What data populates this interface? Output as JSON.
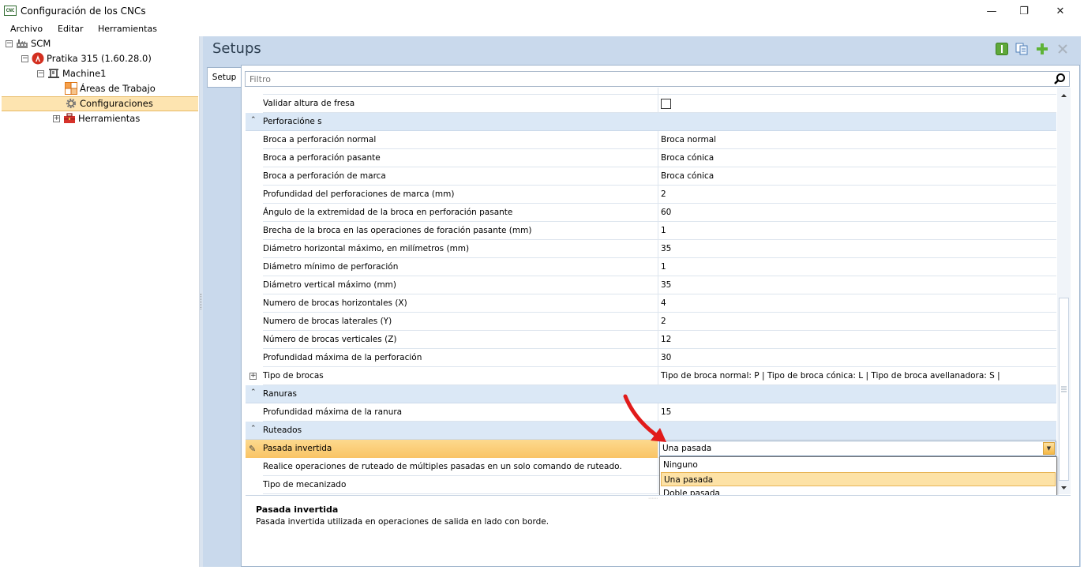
{
  "window": {
    "title": "Configuración de los CNCs",
    "icon_text": "CNC",
    "minimize": "—",
    "maximize": "❐",
    "close": "✕"
  },
  "menu": [
    "Archivo",
    "Editar",
    "Herramientas"
  ],
  "tree": {
    "root": "SCM",
    "machine_group": "Pratika 315 (1.60.28.0)",
    "machine": "Machine1",
    "items": [
      "Áreas de Trabajo",
      "Configuraciones",
      "Herramientas"
    ],
    "selected": "Configuraciones"
  },
  "header": {
    "title": "Setups"
  },
  "side_tab": "Setup",
  "filter": {
    "placeholder": "Filtro"
  },
  "grid": {
    "top_row": {
      "name": "Validar altura de fresa",
      "value_type": "checkbox",
      "checked": false
    },
    "categories": [
      {
        "label": "Perforacióne s",
        "rows": []
      }
    ],
    "cat_perforaciones": "Perforacióne s",
    "perforaciones": [
      {
        "name": "Broca a perforación normal",
        "value": "Broca normal"
      },
      {
        "name": "Broca a perforación pasante",
        "value": "Broca cónica"
      },
      {
        "name": "Broca a perforación de marca",
        "value": "Broca cónica"
      },
      {
        "name": "Profundidad del perforaciones de marca (mm)",
        "value": "2"
      },
      {
        "name": "Ángulo de la extremidad de la broca en perforación pasante",
        "value": "60"
      },
      {
        "name": "Brecha de la broca en las operaciones de foración pasante (mm)",
        "value": "1"
      },
      {
        "name": "Diámetro horizontal máximo, en milímetros (mm)",
        "value": "35"
      },
      {
        "name": "Diámetro mínimo de perforación",
        "value": "1"
      },
      {
        "name": "Diámetro vertical máximo (mm)",
        "value": "35"
      },
      {
        "name": "Numero de brocas horizontales (X)",
        "value": "4"
      },
      {
        "name": "Numero de brocas laterales (Y)",
        "value": "2"
      },
      {
        "name": "Número de brocas verticales (Z)",
        "value": "12"
      },
      {
        "name": "Profundidad máxima de la perforación",
        "value": "30"
      },
      {
        "name": "Tipo de brocas",
        "value": "Tipo de broca normal: P  |  Tipo de broca cónica: L  |  Tipo de broca avellanadora: S  |"
      }
    ],
    "cat_ranuras": "Ranuras",
    "ranuras": [
      {
        "name": "Profundidad máxima de la ranura",
        "value": "15"
      }
    ],
    "cat_ruteados": "Ruteados",
    "ruteados": [
      {
        "name": "Pasada invertida",
        "value": "Una pasada"
      },
      {
        "name": "Realice operaciones de ruteado de múltiples pasadas en un solo comando de ruteado.",
        "value": ""
      },
      {
        "name": "Tipo de mecanizado",
        "value": ""
      }
    ]
  },
  "dropdown": {
    "options": [
      "Ninguno",
      "Una pasada",
      "Doble pasada"
    ],
    "selected": "Una pasada"
  },
  "description": {
    "title": "Pasada invertida",
    "text": "Pasada invertida utilizada en operaciones de salida en lado con borde."
  },
  "colors": {
    "selection": "#fde4b0",
    "category": "#dbe8f6",
    "panel": "#c9d9ec",
    "annotation_arrow": "#e11b1b"
  },
  "icons": [
    "search-icon",
    "info-icon",
    "copy-icon",
    "add-icon",
    "delete-icon",
    "pencil-icon",
    "factory-icon",
    "machine-icon",
    "work-areas-icon",
    "gear-icon",
    "toolbox-icon"
  ]
}
